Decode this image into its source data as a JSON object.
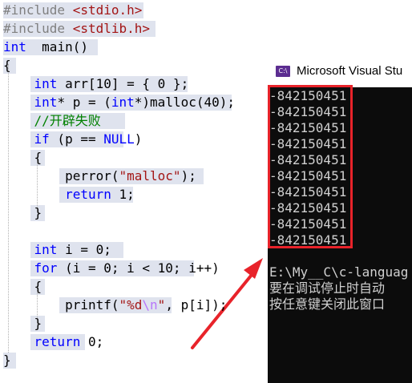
{
  "editor": {
    "lines": [
      {
        "segments": [
          {
            "t": "#include ",
            "cls": "g"
          },
          {
            "t": "<stdio.h>",
            "cls": "s"
          }
        ]
      },
      {
        "segments": [
          {
            "t": "#include ",
            "cls": "g"
          },
          {
            "t": "<stdlib.h>",
            "cls": "s"
          }
        ]
      },
      {
        "segments": [
          {
            "t": "int",
            "cls": "k"
          },
          {
            "t": "  main()",
            "cls": ""
          }
        ]
      },
      {
        "segments": [
          {
            "t": "{",
            "cls": ""
          }
        ]
      },
      {
        "segments": [
          {
            "t": "    ",
            "cls": ""
          },
          {
            "t": "int",
            "cls": "k"
          },
          {
            "t": " arr[10] = { 0 };",
            "cls": ""
          }
        ]
      },
      {
        "segments": [
          {
            "t": "    ",
            "cls": ""
          },
          {
            "t": "int",
            "cls": "k"
          },
          {
            "t": "* p = (",
            "cls": ""
          },
          {
            "t": "int",
            "cls": "k"
          },
          {
            "t": "*)malloc(40);",
            "cls": ""
          }
        ]
      },
      {
        "segments": [
          {
            "t": "    ",
            "cls": ""
          },
          {
            "t": "//开辟失败",
            "cls": "c"
          }
        ]
      },
      {
        "segments": [
          {
            "t": "    ",
            "cls": ""
          },
          {
            "t": "if",
            "cls": "k"
          },
          {
            "t": " (p == ",
            "cls": ""
          },
          {
            "t": "NULL",
            "cls": "k"
          },
          {
            "t": ")",
            "cls": ""
          }
        ]
      },
      {
        "segments": [
          {
            "t": "    {",
            "cls": ""
          }
        ]
      },
      {
        "segments": [
          {
            "t": "        perror(",
            "cls": ""
          },
          {
            "t": "\"malloc\"",
            "cls": "s"
          },
          {
            "t": ");",
            "cls": ""
          }
        ]
      },
      {
        "segments": [
          {
            "t": "        ",
            "cls": ""
          },
          {
            "t": "return",
            "cls": "k"
          },
          {
            "t": " 1;",
            "cls": ""
          }
        ]
      },
      {
        "segments": [
          {
            "t": "    }",
            "cls": ""
          }
        ]
      },
      {
        "segments": []
      },
      {
        "segments": [
          {
            "t": "    ",
            "cls": ""
          },
          {
            "t": "int",
            "cls": "k"
          },
          {
            "t": " i = 0;",
            "cls": ""
          }
        ]
      },
      {
        "segments": [
          {
            "t": "    ",
            "cls": ""
          },
          {
            "t": "for",
            "cls": "k"
          },
          {
            "t": " (i = 0; i < 10; i++)",
            "cls": ""
          }
        ]
      },
      {
        "segments": [
          {
            "t": "    {",
            "cls": ""
          }
        ]
      },
      {
        "segments": [
          {
            "t": "        printf(",
            "cls": ""
          },
          {
            "t": "\"%d",
            "cls": "s"
          },
          {
            "t": "\\n",
            "cls": "esc"
          },
          {
            "t": "\"",
            "cls": "s"
          },
          {
            "t": ", p[i]);",
            "cls": ""
          }
        ]
      },
      {
        "segments": [
          {
            "t": "    }",
            "cls": ""
          }
        ]
      },
      {
        "segments": [
          {
            "t": "    ",
            "cls": ""
          },
          {
            "t": "return",
            "cls": "k"
          },
          {
            "t": " 0;",
            "cls": ""
          }
        ]
      },
      {
        "segments": [
          {
            "t": "}",
            "cls": ""
          }
        ]
      }
    ]
  },
  "console": {
    "title": "Microsoft Visual Stu",
    "icon_label": "C:\\",
    "output": [
      "-842150451",
      "-842150451",
      "-842150451",
      "-842150451",
      "-842150451",
      "-842150451",
      "-842150451",
      "-842150451",
      "-842150451",
      "-842150451",
      "",
      "E:\\My__C\\c-languag",
      "要在调试停止时自动",
      "按任意键关闭此窗口"
    ]
  },
  "annotation": {
    "box_color": "#e8232a",
    "arrow_color": "#e8232a"
  }
}
